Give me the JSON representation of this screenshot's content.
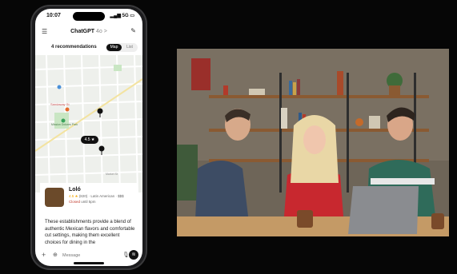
{
  "status": {
    "time": "10:07",
    "signal": "5G"
  },
  "header": {
    "title": "ChatGPT",
    "model_suffix": "4o >"
  },
  "recommendations": {
    "count_label": "4 recommendations",
    "map_tab": "Map",
    "list_tab": "List"
  },
  "map": {
    "rating_pill": "4.5 ★",
    "labels": [
      "Sandaway St",
      "Mission Dolores Park",
      "Market St"
    ]
  },
  "place": {
    "name": "Loló",
    "rating": "4.5 ★",
    "reviews": "(820)",
    "category": "· Latin American · $$$",
    "closed": "Closed",
    "opens": "until 5pm"
  },
  "chat": {
    "description": "These establishments provide a blend of authentic Mexican flavors and comfortable cut settings, making them excellent choices for dining in the"
  },
  "composer": {
    "placeholder": "Message"
  },
  "colors": {
    "map_bg": "#eef0ec",
    "road": "#ffffff",
    "park": "#c9e6c3",
    "pin": "#111111",
    "accent_red": "#d93025"
  }
}
